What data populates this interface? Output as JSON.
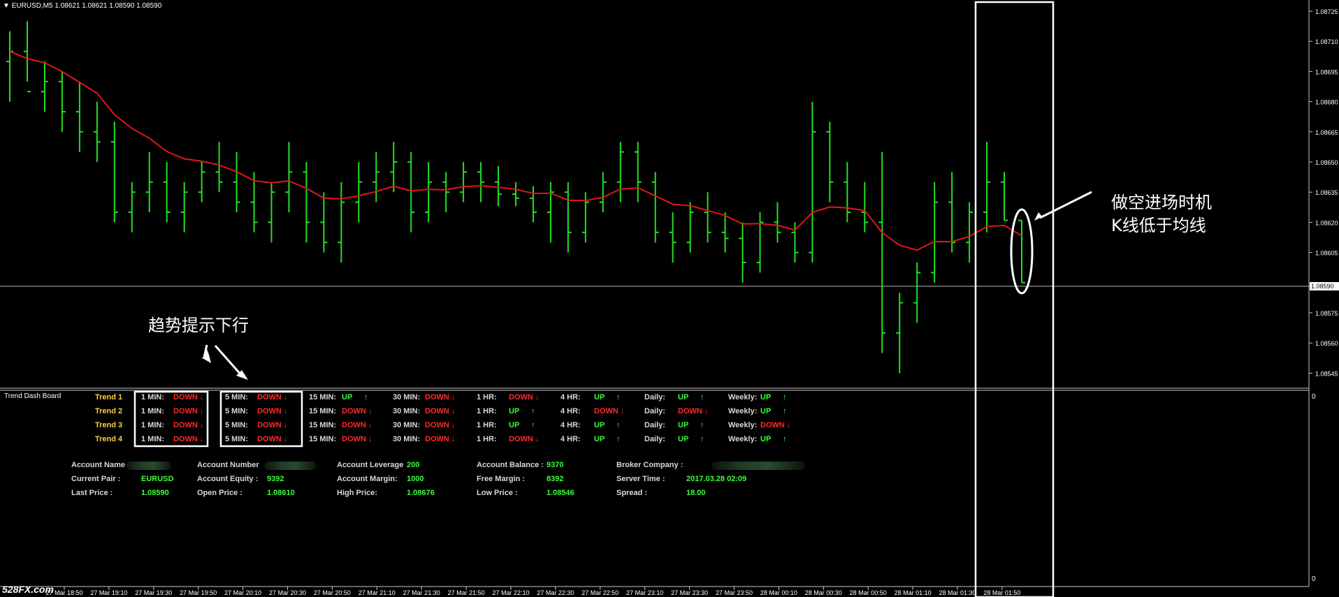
{
  "header": {
    "symbol": "EURUSD,M5",
    "ohlc": "1.08621 1.08621 1.08590 1.08590"
  },
  "price_scale": [
    "1.08725",
    "1.08710",
    "1.08695",
    "1.08680",
    "1.08665",
    "1.08650",
    "1.08635",
    "1.08620",
    "1.08605",
    "1.08590",
    "1.08575",
    "1.08560",
    "1.08545"
  ],
  "current_price_label": "1.08590",
  "subwindow_scale": {
    "top": "0",
    "bottom": "0"
  },
  "time_axis": [
    "27 Mar 18:50",
    "27 Mar 19:10",
    "27 Mar 19:30",
    "27 Mar 19:50",
    "27 Mar 20:10",
    "27 Mar 20:30",
    "27 Mar 20:50",
    "27 Mar 21:10",
    "27 Mar 21:30",
    "27 Mar 21:50",
    "27 Mar 22:10",
    "27 Mar 22:30",
    "27 Mar 22:50",
    "27 Mar 23:10",
    "27 Mar 23:30",
    "27 Mar 23:50",
    "28 Mar 00:10",
    "28 Mar 00:30",
    "28 Mar 00:50",
    "28 Mar 01:10",
    "28 Mar 01:30",
    "28 Mar 01:50"
  ],
  "watermark": "528FX.com",
  "annotations": {
    "trend_hint": "趋势提示下行",
    "entry_line1": "做空进场时机",
    "entry_line2": "K线低于均线"
  },
  "dashboard": {
    "title": "Trend Dash Board",
    "rows": [
      {
        "name": "Trend 1",
        "cells": [
          {
            "tf": "1 MIN:",
            "dir": "DOWN"
          },
          {
            "tf": "5 MIN:",
            "dir": "DOWN"
          },
          {
            "tf": "15 MIN:",
            "dir": "UP"
          },
          {
            "tf": "30 MIN:",
            "dir": "DOWN"
          },
          {
            "tf": "1 HR:",
            "dir": "DOWN"
          },
          {
            "tf": "4 HR:",
            "dir": "UP"
          },
          {
            "tf": "Daily:",
            "dir": "UP"
          },
          {
            "tf": "Weekly:",
            "dir": "UP"
          }
        ]
      },
      {
        "name": "Trend 2",
        "cells": [
          {
            "tf": "1 MIN:",
            "dir": "DOWN"
          },
          {
            "tf": "5 MIN:",
            "dir": "DOWN"
          },
          {
            "tf": "15 MIN:",
            "dir": "DOWN"
          },
          {
            "tf": "30 MIN:",
            "dir": "DOWN"
          },
          {
            "tf": "1 HR:",
            "dir": "UP"
          },
          {
            "tf": "4 HR:",
            "dir": "DOWN"
          },
          {
            "tf": "Daily:",
            "dir": "DOWN"
          },
          {
            "tf": "Weekly:",
            "dir": "UP"
          }
        ]
      },
      {
        "name": "Trend 3",
        "cells": [
          {
            "tf": "1 MIN:",
            "dir": "DOWN"
          },
          {
            "tf": "5 MIN:",
            "dir": "DOWN"
          },
          {
            "tf": "15 MIN:",
            "dir": "DOWN"
          },
          {
            "tf": "30 MIN:",
            "dir": "DOWN"
          },
          {
            "tf": "1 HR:",
            "dir": "UP"
          },
          {
            "tf": "4 HR:",
            "dir": "UP"
          },
          {
            "tf": "Daily:",
            "dir": "UP"
          },
          {
            "tf": "Weekly:",
            "dir": "DOWN"
          }
        ]
      },
      {
        "name": "Trend 4",
        "cells": [
          {
            "tf": "1 MIN:",
            "dir": "DOWN"
          },
          {
            "tf": "5 MIN:",
            "dir": "DOWN"
          },
          {
            "tf": "15 MIN:",
            "dir": "DOWN"
          },
          {
            "tf": "30 MIN:",
            "dir": "DOWN"
          },
          {
            "tf": "1 HR:",
            "dir": "DOWN"
          },
          {
            "tf": "4 HR:",
            "dir": "UP"
          },
          {
            "tf": "Daily:",
            "dir": "UP"
          },
          {
            "tf": "Weekly:",
            "dir": "UP"
          }
        ]
      }
    ]
  },
  "account": {
    "rows": [
      [
        {
          "label": "Account Name",
          "value": ""
        },
        {
          "label": "Account Number",
          "value": ""
        },
        {
          "label": "Account Leverage",
          "value": "200"
        },
        {
          "label": "Account Balance :",
          "value": "9370"
        },
        {
          "label": "Broker Company :",
          "value": ""
        }
      ],
      [
        {
          "label": "Current Pair :",
          "value": "EURUSD"
        },
        {
          "label": "Account Equity :",
          "value": "9392"
        },
        {
          "label": "Account Margin:",
          "value": "1000"
        },
        {
          "label": "Free Margin :",
          "value": "8392"
        },
        {
          "label": "Server Time :",
          "value": "2017.03.28 02:09"
        }
      ],
      [
        {
          "label": "Last Price :",
          "value": "1.08590"
        },
        {
          "label": "Open Price :",
          "value": "1.08610"
        },
        {
          "label": "High Price:",
          "value": "1.08676"
        },
        {
          "label": "Low Price :",
          "value": "1.08546"
        },
        {
          "label": "Spread :",
          "value": "18.00"
        }
      ]
    ]
  },
  "colors": {
    "up": "#3cff3c",
    "down": "#ff2a2a",
    "candle": "#22e022",
    "ma": "#e01818",
    "label": "#ffd23c"
  },
  "chart_data": {
    "type": "line",
    "title": "EURUSD,M5",
    "ylim": [
      1.0854,
      1.0873
    ],
    "bar_ohlc_note": "high/low/open/close per 5-minute bar (estimated)",
    "bars": [
      [
        1.087,
        1.08715,
        1.0868,
        1.08705
      ],
      [
        1.08705,
        1.0872,
        1.0869,
        1.08685
      ],
      [
        1.08685,
        1.087,
        1.08675,
        1.0869
      ],
      [
        1.0869,
        1.08695,
        1.08665,
        1.08675
      ],
      [
        1.08675,
        1.0869,
        1.08655,
        1.08665
      ],
      [
        1.08665,
        1.0868,
        1.0865,
        1.0866
      ],
      [
        1.0866,
        1.0867,
        1.0862,
        1.08625
      ],
      [
        1.08625,
        1.0864,
        1.08615,
        1.08635
      ],
      [
        1.08635,
        1.08655,
        1.08625,
        1.0864
      ],
      [
        1.0864,
        1.0865,
        1.0862,
        1.08625
      ],
      [
        1.08625,
        1.0864,
        1.08615,
        1.08635
      ],
      [
        1.08635,
        1.0865,
        1.0863,
        1.08645
      ],
      [
        1.08645,
        1.0866,
        1.08635,
        1.0864
      ],
      [
        1.0864,
        1.08655,
        1.08625,
        1.0863
      ],
      [
        1.0863,
        1.08645,
        1.08615,
        1.0862
      ],
      [
        1.0862,
        1.0864,
        1.0861,
        1.08635
      ],
      [
        1.08635,
        1.0866,
        1.08625,
        1.08645
      ],
      [
        1.08645,
        1.0865,
        1.0861,
        1.0862
      ],
      [
        1.0862,
        1.08635,
        1.08605,
        1.0861
      ],
      [
        1.0861,
        1.0864,
        1.086,
        1.0863
      ],
      [
        1.0863,
        1.0865,
        1.0862,
        1.0864
      ],
      [
        1.0864,
        1.08655,
        1.0863,
        1.08645
      ],
      [
        1.08645,
        1.0866,
        1.08635,
        1.0865
      ],
      [
        1.0865,
        1.08655,
        1.08615,
        1.08625
      ],
      [
        1.08625,
        1.0865,
        1.0862,
        1.0864
      ],
      [
        1.0864,
        1.08645,
        1.08625,
        1.08635
      ],
      [
        1.08635,
        1.0865,
        1.0863,
        1.08645
      ],
      [
        1.08645,
        1.0865,
        1.0863,
        1.0864
      ],
      [
        1.0864,
        1.08648,
        1.08628,
        1.08634
      ],
      [
        1.08634,
        1.0864,
        1.08628,
        1.08632
      ],
      [
        1.08632,
        1.08638,
        1.0862,
        1.08625
      ],
      [
        1.08625,
        1.0864,
        1.0861,
        1.08635
      ],
      [
        1.08635,
        1.0864,
        1.08605,
        1.08615
      ],
      [
        1.08615,
        1.08635,
        1.0861,
        1.0863
      ],
      [
        1.0863,
        1.08645,
        1.08625,
        1.0864
      ],
      [
        1.0864,
        1.0866,
        1.0863,
        1.08655
      ],
      [
        1.08655,
        1.0866,
        1.0863,
        1.0864
      ],
      [
        1.0864,
        1.08645,
        1.0861,
        1.08615
      ],
      [
        1.08615,
        1.08625,
        1.086,
        1.0861
      ],
      [
        1.0861,
        1.0863,
        1.08605,
        1.08625
      ],
      [
        1.08625,
        1.08635,
        1.0861,
        1.08615
      ],
      [
        1.08615,
        1.08625,
        1.08605,
        1.08612
      ],
      [
        1.08612,
        1.0862,
        1.0859,
        1.086
      ],
      [
        1.086,
        1.08625,
        1.08595,
        1.0862
      ],
      [
        1.0862,
        1.0863,
        1.0861,
        1.08615
      ],
      [
        1.08615,
        1.0862,
        1.086,
        1.08605
      ],
      [
        1.08605,
        1.0868,
        1.086,
        1.08665
      ],
      [
        1.08665,
        1.0867,
        1.0863,
        1.0864
      ],
      [
        1.0864,
        1.0865,
        1.0862,
        1.08625
      ],
      [
        1.08625,
        1.0864,
        1.08615,
        1.0862
      ],
      [
        1.0862,
        1.08655,
        1.08555,
        1.08565
      ],
      [
        1.08565,
        1.08585,
        1.08545,
        1.0858
      ],
      [
        1.0858,
        1.086,
        1.0857,
        1.08595
      ],
      [
        1.08595,
        1.0864,
        1.0859,
        1.0863
      ],
      [
        1.0863,
        1.08645,
        1.08605,
        1.0861
      ],
      [
        1.0861,
        1.0863,
        1.086,
        1.08625
      ],
      [
        1.08625,
        1.0866,
        1.08615,
        1.0864
      ],
      [
        1.0864,
        1.08645,
        1.08621,
        1.08621
      ],
      [
        1.08621,
        1.08621,
        1.0859,
        1.0859
      ]
    ]
  }
}
